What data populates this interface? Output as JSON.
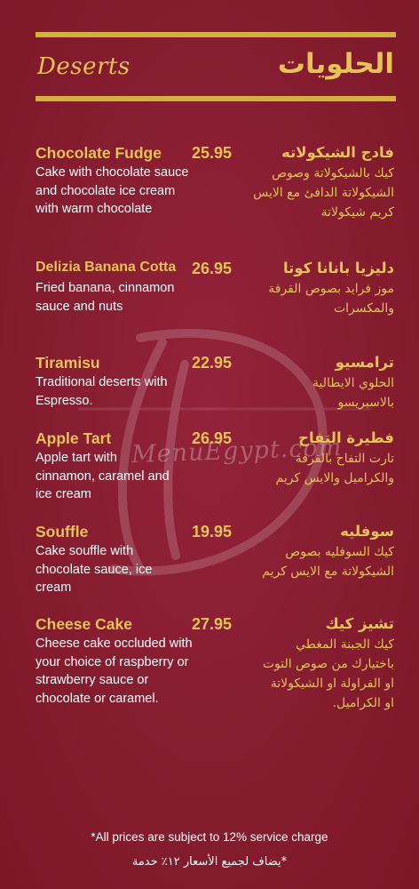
{
  "header": {
    "title_en": "Deserts",
    "title_ar": "الحلويات"
  },
  "watermark": {
    "text": "MenuEgypt.com"
  },
  "items": [
    {
      "name_en": "Chocolate Fudge",
      "price": "25.95",
      "desc_en": "Cake with chocolate sauce and chocolate ice cream with warm chocolate",
      "name_ar": "فادج الشيكولاته",
      "desc_ar": "كيك بالشيكولاتة وصوص الشيكولاتة الدافئ مع الايس كريم شيكولاتة"
    },
    {
      "name_en": "Delizia Banana Cotta",
      "price": "26.95",
      "desc_en": "Fried banana, cinnamon sauce and nuts",
      "name_ar": "دليزيا بانانا كوتا",
      "desc_ar": "موز فرايد بصوص القرفة والمكسرات"
    },
    {
      "name_en": "Tiramisu",
      "price": "22.95",
      "desc_en": "Traditional deserts with Espresso.",
      "name_ar": "ترامسيو",
      "desc_ar": "الحلوي الايطالية بالاسبريسو"
    },
    {
      "name_en": "Apple Tart",
      "price": "26.95",
      "desc_en": "Apple tart with cinnamon, caramel and ice cream",
      "name_ar": "فطيرة التفاح",
      "desc_ar": "تارت التفاح بالقرفة والكراميل والايس كريم"
    },
    {
      "name_en": "Souffle",
      "price": "19.95",
      "desc_en": "Cake souffle with chocolate sauce, ice cream",
      "name_ar": "سوفليه",
      "desc_ar": "كيك السوفليه بصوص الشيكولاتة مع الايس كريم"
    },
    {
      "name_en": "Cheese Cake",
      "price": "27.95",
      "desc_en": "Cheese cake occluded with your choice of raspberry or strawberry sauce or chocolate or caramel.",
      "name_ar": "تشيز كيك",
      "desc_ar": "كيك الجبنة المغطي باختيارك من صوص التوت او الفراولة او الشيكولاتة او الكراميل."
    }
  ],
  "footer": {
    "note_en": "*All prices are subject to 12% service charge",
    "note_ar": "*يضاف لجميع الأسعار ١٢٪ خدمة"
  },
  "colors": {
    "background": "#8a1f30",
    "gold": "#e7c257",
    "rule": "#d4b040",
    "text": "#ffffff"
  }
}
